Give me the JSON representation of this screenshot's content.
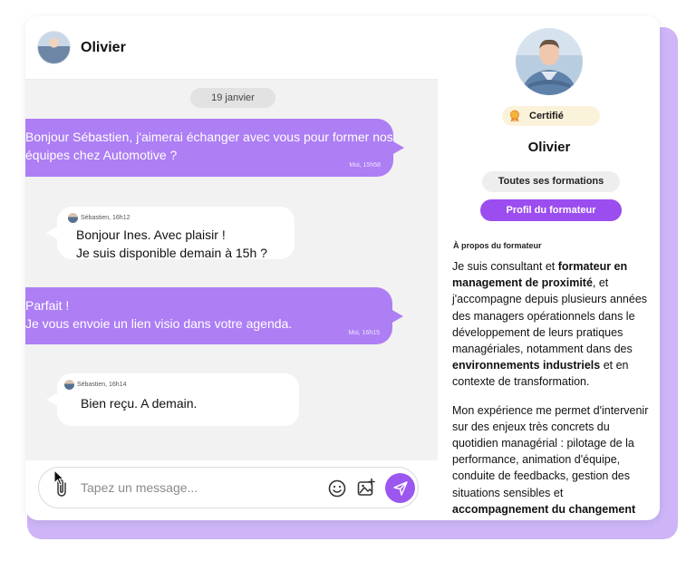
{
  "chat": {
    "contact_name": "Olivier",
    "date_separator": "19 janvier",
    "messages": [
      {
        "direction": "out",
        "text": "Bonjour Sébastien, j'aimerai échanger avec vous pour former nos équipes chez Automotive ?",
        "meta": "Moi, 15h58"
      },
      {
        "direction": "in",
        "sender": "Sébastien, 16h12",
        "lines": [
          "Bonjour Ines. Avec plaisir !",
          "Je suis disponible demain à 15h ?"
        ]
      },
      {
        "direction": "out",
        "lines": [
          "Parfait !",
          "Je vous envoie un lien visio dans votre agenda."
        ],
        "meta": "Moi, 16h15"
      },
      {
        "direction": "in",
        "sender": "Sébastien, 16h14",
        "lines": [
          "Bien reçu. A demain."
        ]
      }
    ],
    "composer": {
      "placeholder": "Tapez un message...",
      "attach_icon": "paperclip-icon",
      "emoji_icon": "smiley-icon",
      "image_icon": "add-image-icon",
      "send_icon": "send-icon"
    }
  },
  "profile": {
    "badge": "Certifié",
    "name": "Olivier",
    "all_trainings_button": "Toutes ses formations",
    "trainer_profile_button": "Profil du formateur",
    "about_title": "À propos du formateur",
    "about_p1": [
      {
        "t": "Je suis consultant et ",
        "b": false
      },
      {
        "t": "formateur en management de proximité",
        "b": true
      },
      {
        "t": ", et j'accompagne depuis plusieurs années des managers opérationnels dans le développement de leurs pratiques managériales, notamment dans des ",
        "b": false
      },
      {
        "t": "environnements industriels",
        "b": true
      },
      {
        "t": " et en contexte de transformation.",
        "b": false
      }
    ],
    "about_p2": [
      {
        "t": "Mon expérience me permet d'intervenir sur des enjeux très concrets du quotidien managérial : pilotage de la performance, animation d'équipe, conduite de feedbacks, gestion des situations sensibles et ",
        "b": false
      },
      {
        "t": "accompagnement du changement",
        "b": true
      }
    ]
  },
  "colors": {
    "accent": "#9b4df0",
    "outgoing_bubble": "#ad7ef4",
    "backdrop": "#cdb5f7",
    "badge_bg": "#fbf2da"
  }
}
